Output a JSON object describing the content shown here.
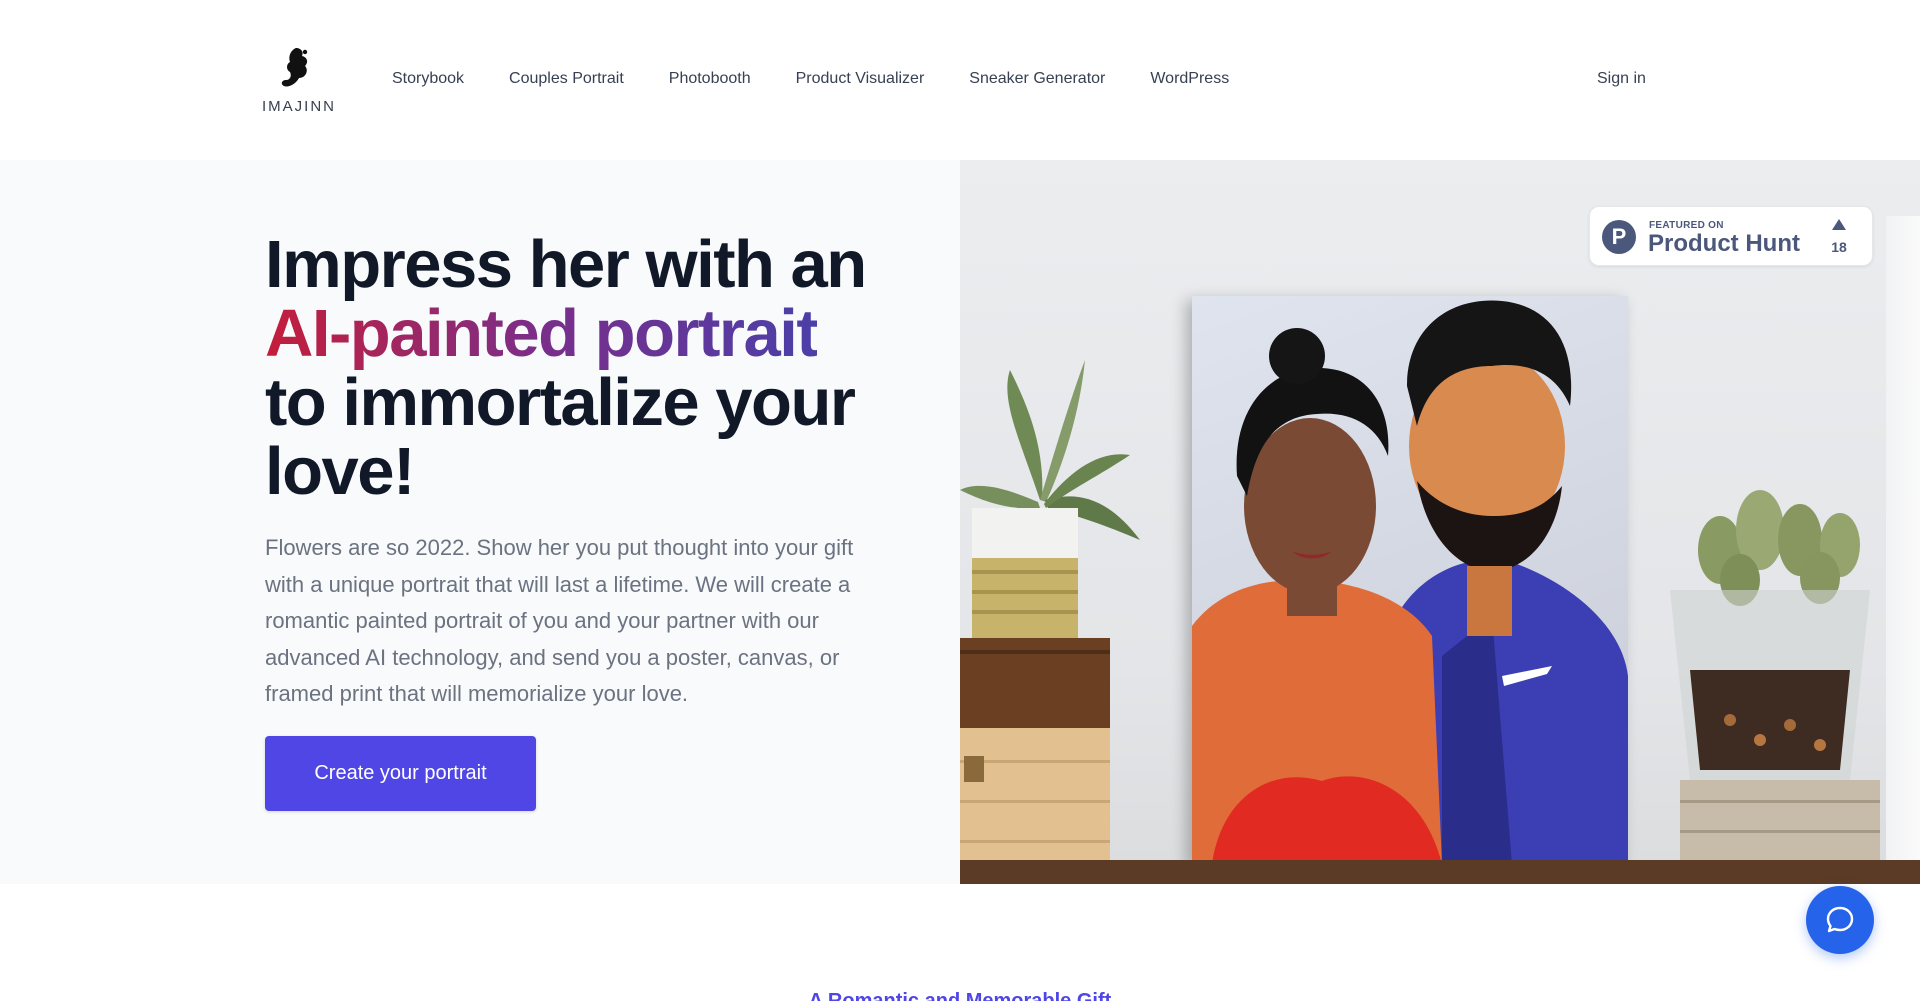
{
  "header": {
    "logo_text": "IMAJINN",
    "nav": [
      {
        "label": "Storybook"
      },
      {
        "label": "Couples Portrait"
      },
      {
        "label": "Photobooth"
      },
      {
        "label": "Product Visualizer"
      },
      {
        "label": "Sneaker Generator"
      },
      {
        "label": "WordPress"
      }
    ],
    "signin_label": "Sign in"
  },
  "hero": {
    "headline_line1": "Impress her with an",
    "headline_highlight": "AI-painted portrait",
    "headline_line3": "to immortalize your love!",
    "description": "Flowers are so 2022. Show her you put thought into your gift with a unique portrait that will last a lifetime. We will create a romantic painted portrait of you and your partner with our advanced AI technology, and send you a poster, canvas, or framed print that will memorialize your love.",
    "cta_label": "Create your portrait"
  },
  "product_hunt": {
    "logo_letter": "P",
    "featured_label": "FEATURED ON",
    "name": "Product Hunt",
    "upvotes": "18"
  },
  "section": {
    "subtitle": "A Romantic and Memorable Gift"
  },
  "colors": {
    "accent": "#4f46e5",
    "chat": "#2563eb",
    "gradient_start": "#c41e3a",
    "gradient_end": "#4b3fa8",
    "product_hunt": "#4b587c"
  },
  "icons": {
    "logo": "imajinn-logo-icon",
    "chat": "chat-bubble-icon",
    "upvote": "triangle-up-icon"
  }
}
